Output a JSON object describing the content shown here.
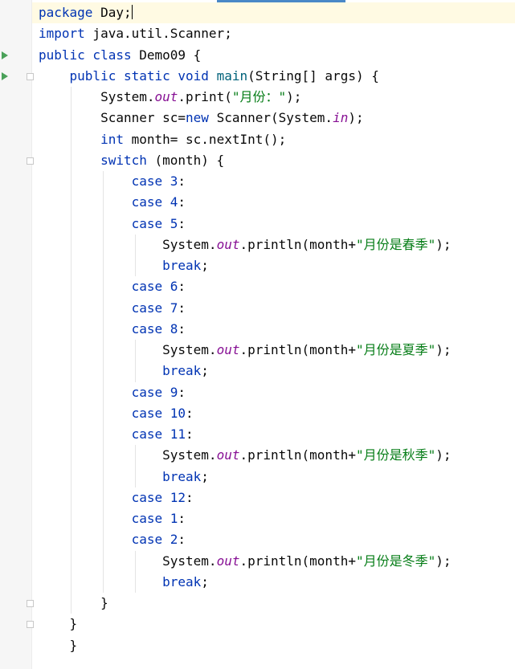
{
  "editor": {
    "lines": [
      [
        {
          "t": "package",
          "c": "kw"
        },
        {
          "t": " Day;"
        }
      ],
      [
        {
          "t": "import",
          "c": "kw"
        },
        {
          "t": " java.util.Scanner;"
        }
      ],
      [
        {
          "t": "public class",
          "c": "kw"
        },
        {
          "t": " Demo09 {"
        }
      ],
      [
        {
          "t": "    "
        },
        {
          "t": "public static void",
          "c": "kw"
        },
        {
          "t": " "
        },
        {
          "t": "main",
          "c": "fn"
        },
        {
          "t": "(String[] args) {"
        }
      ],
      [
        {
          "t": "        System."
        },
        {
          "t": "out",
          "c": "field"
        },
        {
          "t": ".print("
        },
        {
          "t": "\"月份：\"",
          "c": "str"
        },
        {
          "t": ");"
        }
      ],
      [
        {
          "t": "        Scanner sc="
        },
        {
          "t": "new",
          "c": "kw"
        },
        {
          "t": " Scanner(System."
        },
        {
          "t": "in",
          "c": "field"
        },
        {
          "t": ");"
        }
      ],
      [
        {
          "t": "        "
        },
        {
          "t": "int",
          "c": "kw"
        },
        {
          "t": " month= sc.nextInt();"
        }
      ],
      [
        {
          "t": "        "
        },
        {
          "t": "switch",
          "c": "kw"
        },
        {
          "t": " (month) {"
        }
      ],
      [
        {
          "t": "            "
        },
        {
          "t": "case",
          "c": "kw"
        },
        {
          "t": " "
        },
        {
          "t": "3",
          "c": "kw"
        },
        {
          "t": ":"
        }
      ],
      [
        {
          "t": "            "
        },
        {
          "t": "case",
          "c": "kw"
        },
        {
          "t": " "
        },
        {
          "t": "4",
          "c": "kw"
        },
        {
          "t": ":"
        }
      ],
      [
        {
          "t": "            "
        },
        {
          "t": "case",
          "c": "kw"
        },
        {
          "t": " "
        },
        {
          "t": "5",
          "c": "kw"
        },
        {
          "t": ":"
        }
      ],
      [
        {
          "t": "                System."
        },
        {
          "t": "out",
          "c": "field"
        },
        {
          "t": ".println(month+"
        },
        {
          "t": "\"月份是春季\"",
          "c": "str"
        },
        {
          "t": ");"
        }
      ],
      [
        {
          "t": "                "
        },
        {
          "t": "break",
          "c": "kw"
        },
        {
          "t": ";"
        }
      ],
      [
        {
          "t": "            "
        },
        {
          "t": "case",
          "c": "kw"
        },
        {
          "t": " "
        },
        {
          "t": "6",
          "c": "kw"
        },
        {
          "t": ":"
        }
      ],
      [
        {
          "t": "            "
        },
        {
          "t": "case",
          "c": "kw"
        },
        {
          "t": " "
        },
        {
          "t": "7",
          "c": "kw"
        },
        {
          "t": ":"
        }
      ],
      [
        {
          "t": "            "
        },
        {
          "t": "case",
          "c": "kw"
        },
        {
          "t": " "
        },
        {
          "t": "8",
          "c": "kw"
        },
        {
          "t": ":"
        }
      ],
      [
        {
          "t": "                System."
        },
        {
          "t": "out",
          "c": "field"
        },
        {
          "t": ".println(month+"
        },
        {
          "t": "\"月份是夏季\"",
          "c": "str"
        },
        {
          "t": ");"
        }
      ],
      [
        {
          "t": "                "
        },
        {
          "t": "break",
          "c": "kw"
        },
        {
          "t": ";"
        }
      ],
      [
        {
          "t": "            "
        },
        {
          "t": "case",
          "c": "kw"
        },
        {
          "t": " "
        },
        {
          "t": "9",
          "c": "kw"
        },
        {
          "t": ":"
        }
      ],
      [
        {
          "t": "            "
        },
        {
          "t": "case",
          "c": "kw"
        },
        {
          "t": " "
        },
        {
          "t": "10",
          "c": "kw"
        },
        {
          "t": ":"
        }
      ],
      [
        {
          "t": "            "
        },
        {
          "t": "case",
          "c": "kw"
        },
        {
          "t": " "
        },
        {
          "t": "11",
          "c": "kw"
        },
        {
          "t": ":"
        }
      ],
      [
        {
          "t": "                System."
        },
        {
          "t": "out",
          "c": "field"
        },
        {
          "t": ".println(month+"
        },
        {
          "t": "\"月份是秋季\"",
          "c": "str"
        },
        {
          "t": ");"
        }
      ],
      [
        {
          "t": "                "
        },
        {
          "t": "break",
          "c": "kw"
        },
        {
          "t": ";"
        }
      ],
      [
        {
          "t": "            "
        },
        {
          "t": "case",
          "c": "kw"
        },
        {
          "t": " "
        },
        {
          "t": "12",
          "c": "kw"
        },
        {
          "t": ":"
        }
      ],
      [
        {
          "t": "            "
        },
        {
          "t": "case",
          "c": "kw"
        },
        {
          "t": " "
        },
        {
          "t": "1",
          "c": "kw"
        },
        {
          "t": ":"
        }
      ],
      [
        {
          "t": "            "
        },
        {
          "t": "case",
          "c": "kw"
        },
        {
          "t": " "
        },
        {
          "t": "2",
          "c": "kw"
        },
        {
          "t": ":"
        }
      ],
      [
        {
          "t": "                System."
        },
        {
          "t": "out",
          "c": "field"
        },
        {
          "t": ".println(month+"
        },
        {
          "t": "\"月份是冬季\"",
          "c": "str"
        },
        {
          "t": ");"
        }
      ],
      [
        {
          "t": "                "
        },
        {
          "t": "break",
          "c": "kw"
        },
        {
          "t": ";"
        }
      ],
      [
        {
          "t": "        }"
        }
      ],
      [
        {
          "t": "    }"
        }
      ],
      [
        {
          "t": "    }"
        }
      ]
    ],
    "current_line": 1,
    "caret_line": 1,
    "run_gutter_lines": [
      3,
      4
    ],
    "fold_gutter_lines": [
      4,
      8,
      29,
      30
    ],
    "colors": {
      "keyword": "#0033b3",
      "string": "#067d17",
      "static_field": "#871094",
      "method": "#00627a",
      "plain": "#080808",
      "current_line_bg": "#fffae3",
      "run_icon": "#4aa159"
    },
    "icons": {
      "run": "run-gutter-icon",
      "fold": "fold-toggle-icon"
    }
  }
}
